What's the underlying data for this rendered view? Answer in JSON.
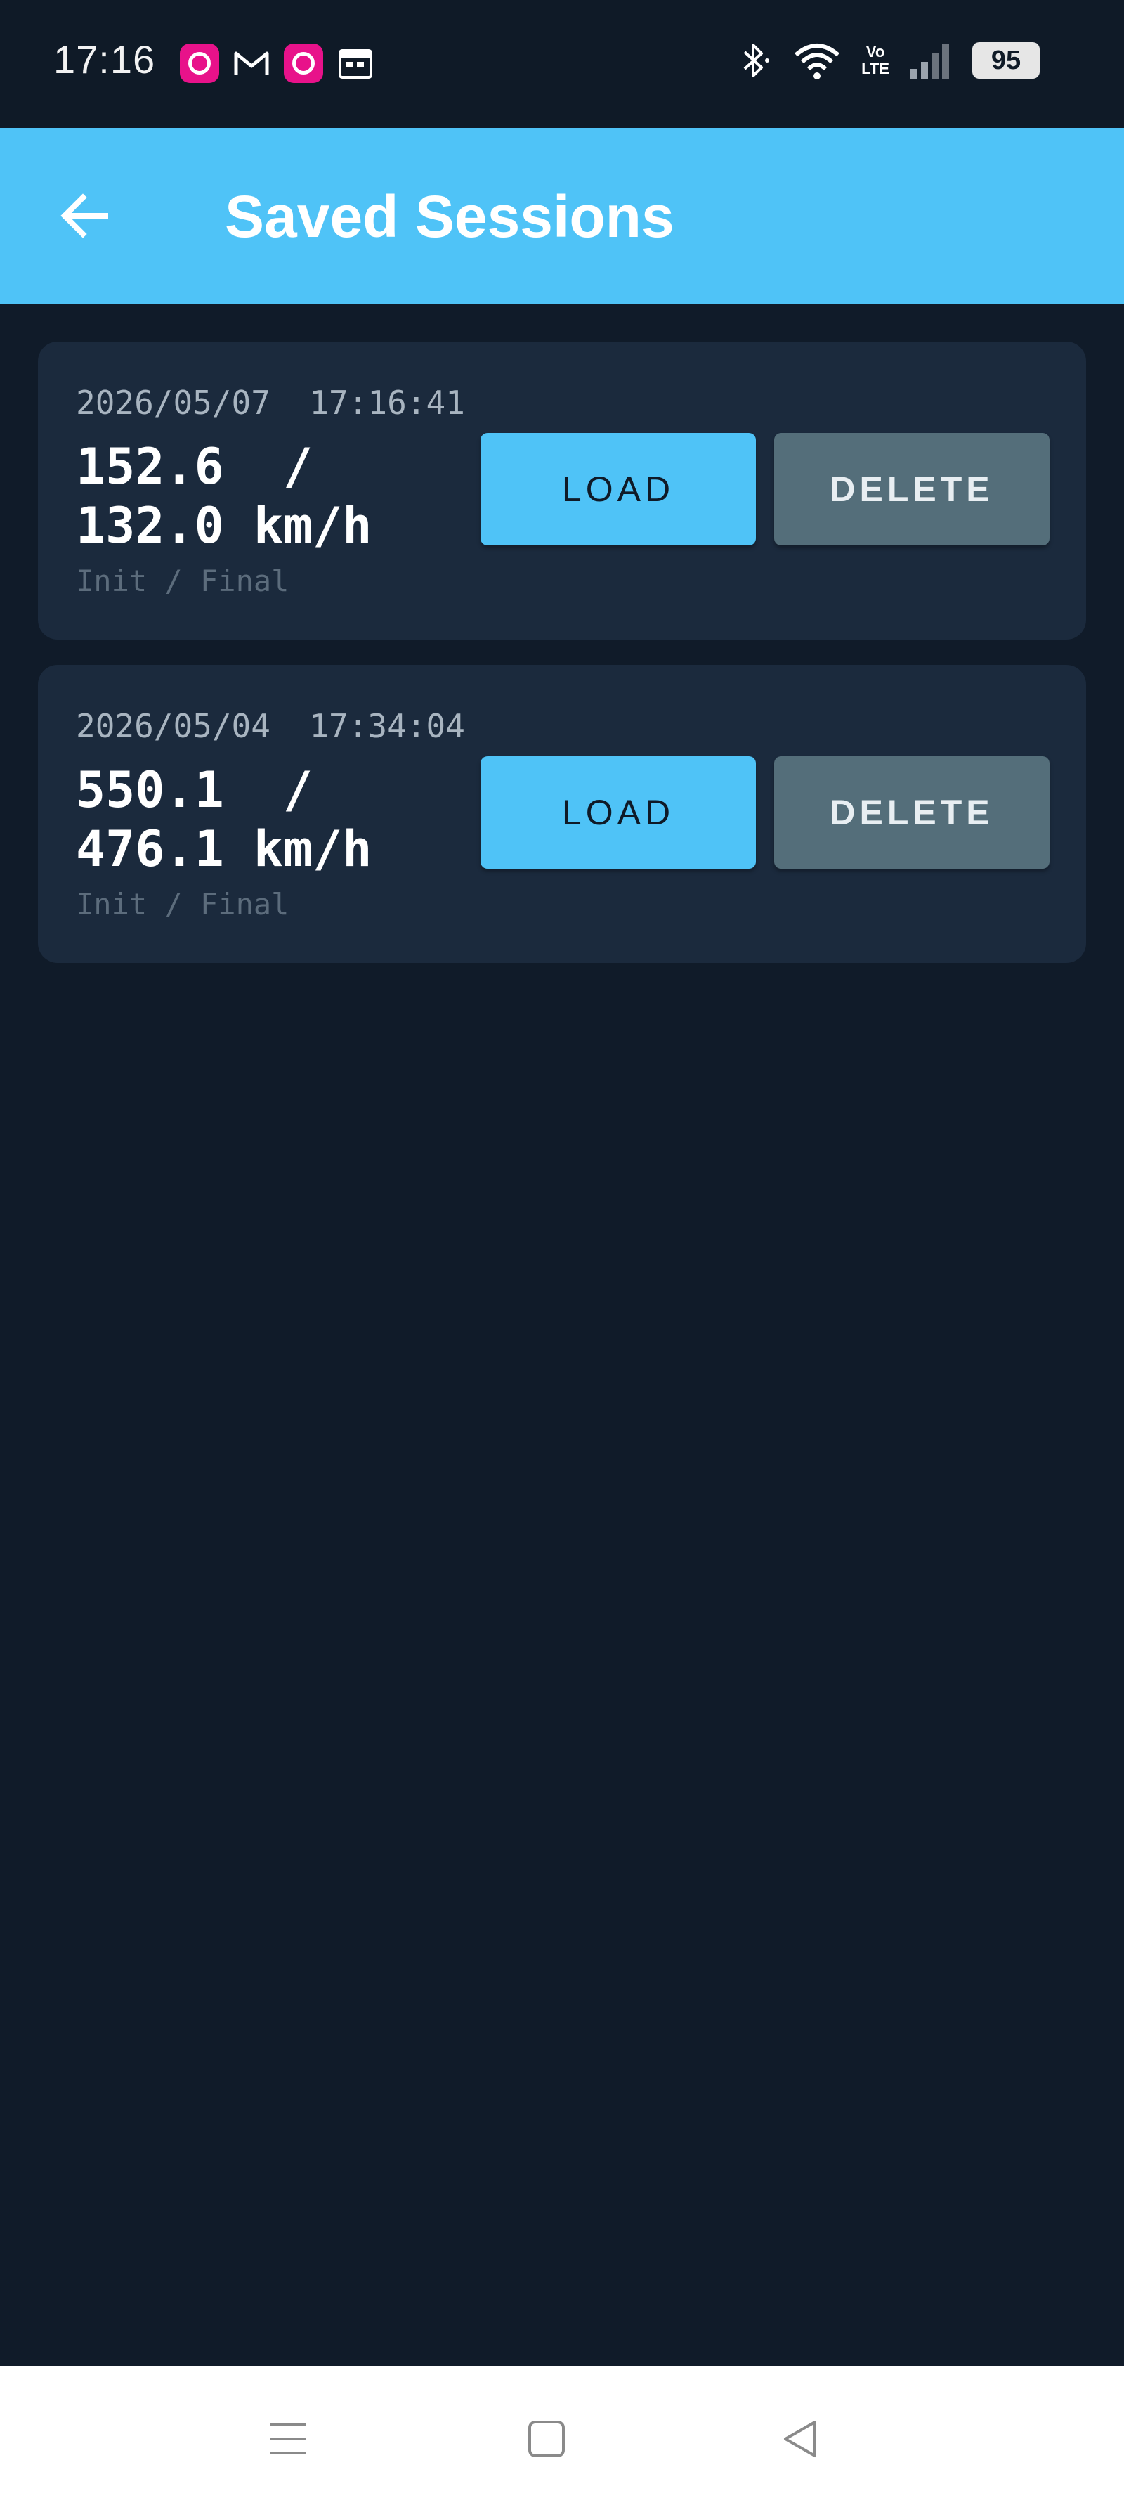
{
  "status_bar": {
    "time": "17:16",
    "battery": "95",
    "volte": "Vo\nLTE",
    "notification_icons": [
      "app-notification-icon",
      "gmail-icon",
      "app-notification-icon",
      "calendar-icon"
    ],
    "system_icons": [
      "bluetooth-icon",
      "wifi-icon",
      "volte-icon",
      "signal-icon",
      "battery-icon"
    ]
  },
  "app_bar": {
    "title": "Saved Sessions",
    "back_icon": "arrow-left-icon",
    "background_color": "#4fc3f7"
  },
  "sessions": [
    {
      "date": "2026/05/07",
      "time": "17:16:41",
      "speed_text": "152.6  / 132.0 km/h",
      "caption": "Init / Final",
      "load_label": "LOAD",
      "delete_label": "DELETE"
    },
    {
      "date": "2026/05/04",
      "time": "17:34:04",
      "speed_text": "550.1  / 476.1 km/h",
      "caption": "Init / Final",
      "load_label": "LOAD",
      "delete_label": "DELETE"
    }
  ],
  "colors": {
    "background": "#101b29",
    "card": "#1b2a3d",
    "accent": "#4fc3f7",
    "delete_button": "#546e7a"
  },
  "nav_bar": {
    "icons": [
      "menu-icon",
      "home-icon",
      "back-icon"
    ]
  }
}
